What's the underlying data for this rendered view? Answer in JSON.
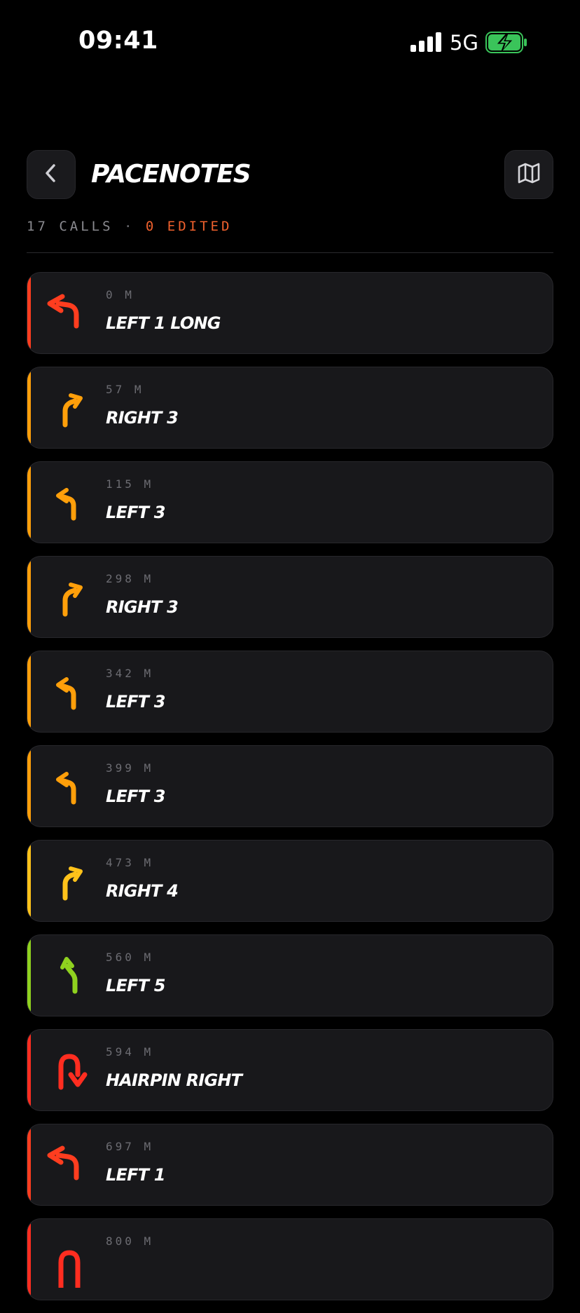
{
  "status_bar": {
    "time": "09:41",
    "network": "5G"
  },
  "header": {
    "title": "PACENOTES",
    "back_icon": "chevron-left-icon",
    "map_icon": "map-icon"
  },
  "summary": {
    "calls": "17 CALLS",
    "separator": "·",
    "edited": "0 EDITED"
  },
  "colors": {
    "severity_1": "#ff3d1f",
    "severity_3": "#ff9f0a",
    "severity_4": "#ffc21a",
    "severity_5": "#8fd11f",
    "hairpin": "#ff2d20",
    "edited": "#f0612d"
  },
  "pacenotes": [
    {
      "distance": "0 M",
      "call": "LEFT 1 LONG",
      "icon": "sharp-left-turn-icon",
      "color": "#ff3d1f"
    },
    {
      "distance": "57 M",
      "call": "RIGHT 3",
      "icon": "right-turn-icon",
      "color": "#ff9f0a"
    },
    {
      "distance": "115 M",
      "call": "LEFT 3",
      "icon": "left-turn-icon",
      "color": "#ff9f0a"
    },
    {
      "distance": "298 M",
      "call": "RIGHT 3",
      "icon": "right-turn-icon",
      "color": "#ff9f0a"
    },
    {
      "distance": "342 M",
      "call": "LEFT 3",
      "icon": "left-turn-icon",
      "color": "#ff9f0a"
    },
    {
      "distance": "399 M",
      "call": "LEFT 3",
      "icon": "left-turn-icon",
      "color": "#ff9f0a"
    },
    {
      "distance": "473 M",
      "call": "RIGHT 4",
      "icon": "right-turn-icon",
      "color": "#ffc21a"
    },
    {
      "distance": "560 M",
      "call": "LEFT 5",
      "icon": "slight-left-icon",
      "color": "#8fd11f"
    },
    {
      "distance": "594 M",
      "call": "HAIRPIN RIGHT",
      "icon": "hairpin-right-icon",
      "color": "#ff2d20"
    },
    {
      "distance": "697 M",
      "call": "LEFT 1",
      "icon": "sharp-left-turn-icon",
      "color": "#ff3d1f"
    },
    {
      "distance": "800 M",
      "call": "",
      "icon": "hairpin-icon",
      "color": "#ff2d20"
    }
  ]
}
